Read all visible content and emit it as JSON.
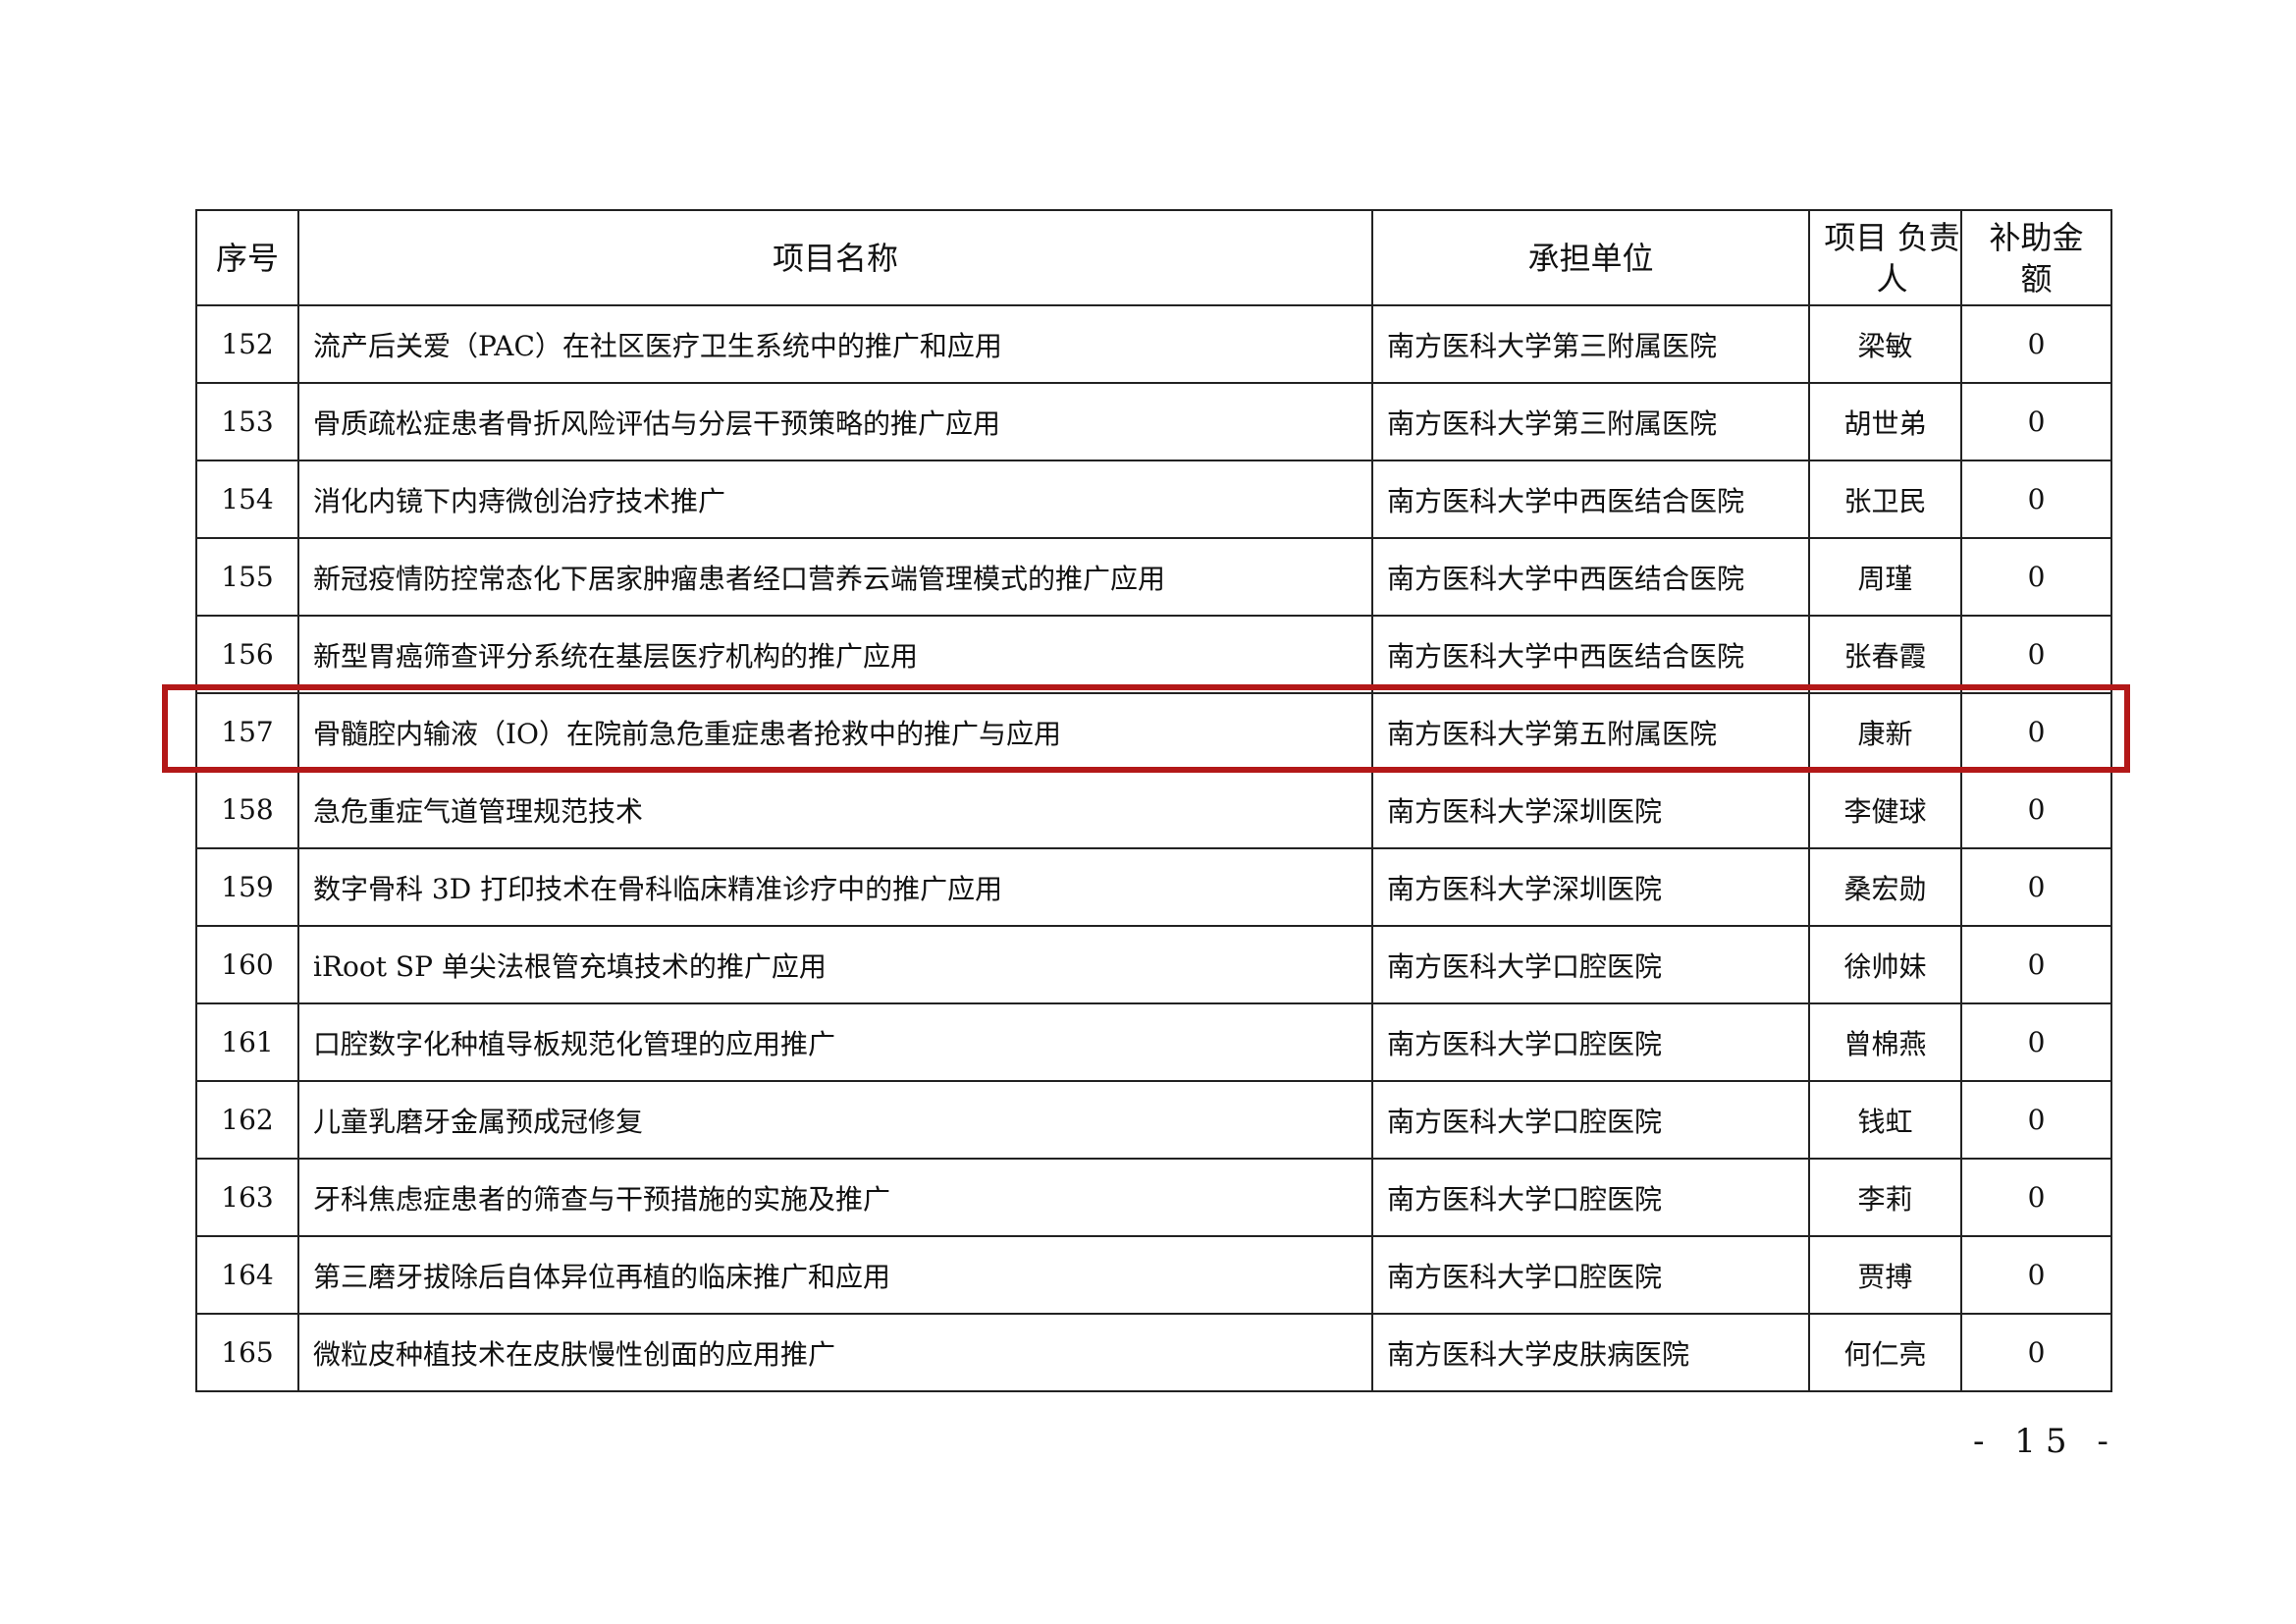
{
  "table": {
    "headers": {
      "num": "序号",
      "name": "项目名称",
      "unit": "承担单位",
      "person": "项目 负责人",
      "amount": "补助金额"
    },
    "rows": [
      {
        "num": "152",
        "name": "流产后关爱（PAC）在社区医疗卫生系统中的推广和应用",
        "unit": "南方医科大学第三附属医院",
        "person": "梁敏",
        "amount": "0"
      },
      {
        "num": "153",
        "name": "骨质疏松症患者骨折风险评估与分层干预策略的推广应用",
        "unit": "南方医科大学第三附属医院",
        "person": "胡世弟",
        "amount": "0"
      },
      {
        "num": "154",
        "name": "消化内镜下内痔微创治疗技术推广",
        "unit": "南方医科大学中西医结合医院",
        "person": "张卫民",
        "amount": "0"
      },
      {
        "num": "155",
        "name": "新冠疫情防控常态化下居家肿瘤患者经口营养云端管理模式的推广应用",
        "unit": "南方医科大学中西医结合医院",
        "person": "周瑾",
        "amount": "0"
      },
      {
        "num": "156",
        "name": "新型胃癌筛查评分系统在基层医疗机构的推广应用",
        "unit": "南方医科大学中西医结合医院",
        "person": "张春霞",
        "amount": "0"
      },
      {
        "num": "157",
        "name": "骨髓腔内输液（IO）在院前急危重症患者抢救中的推广与应用",
        "unit": "南方医科大学第五附属医院",
        "person": "康新",
        "amount": "0"
      },
      {
        "num": "158",
        "name": "急危重症气道管理规范技术",
        "unit": "南方医科大学深圳医院",
        "person": "李健球",
        "amount": "0"
      },
      {
        "num": "159",
        "name": "数字骨科 3D 打印技术在骨科临床精准诊疗中的推广应用",
        "unit": "南方医科大学深圳医院",
        "person": "桑宏勋",
        "amount": "0"
      },
      {
        "num": "160",
        "name": "iRoot SP 单尖法根管充填技术的推广应用",
        "unit": "南方医科大学口腔医院",
        "person": "徐帅妹",
        "amount": "0"
      },
      {
        "num": "161",
        "name": "口腔数字化种植导板规范化管理的应用推广",
        "unit": "南方医科大学口腔医院",
        "person": "曾棉燕",
        "amount": "0"
      },
      {
        "num": "162",
        "name": "儿童乳磨牙金属预成冠修复",
        "unit": "南方医科大学口腔医院",
        "person": "钱虹",
        "amount": "0"
      },
      {
        "num": "163",
        "name": "牙科焦虑症患者的筛查与干预措施的实施及推广",
        "unit": "南方医科大学口腔医院",
        "person": "李莉",
        "amount": "0"
      },
      {
        "num": "164",
        "name": "第三磨牙拔除后自体异位再植的临床推广和应用",
        "unit": "南方医科大学口腔医院",
        "person": "贾搏",
        "amount": "0"
      },
      {
        "num": "165",
        "name": "微粒皮种植技术在皮肤慢性创面的应用推广",
        "unit": "南方医科大学皮肤病医院",
        "person": "何仁亮",
        "amount": "0"
      }
    ]
  },
  "page_number": "- 15 -",
  "colors": {
    "highlight": "#b31818",
    "border": "#222222",
    "text": "#111111"
  }
}
